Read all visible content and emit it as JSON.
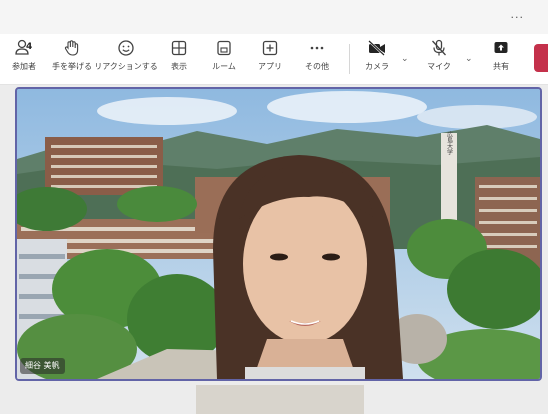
{
  "window": {
    "more_label": "..."
  },
  "toolbar": {
    "participants": {
      "label": "参加者",
      "count": "4",
      "icon": "people-icon"
    },
    "raise_hand": {
      "label": "手を挙げる",
      "icon": "hand-icon"
    },
    "reactions": {
      "label": "リアクションする",
      "icon": "smile-icon"
    },
    "view": {
      "label": "表示",
      "icon": "grid-icon"
    },
    "rooms": {
      "label": "ルーム",
      "icon": "rooms-icon"
    },
    "apps": {
      "label": "アプリ",
      "icon": "plus-square-icon"
    },
    "more": {
      "label": "その他",
      "icon": "ellipsis-icon"
    },
    "camera": {
      "label": "カメラ",
      "state": "off",
      "icon": "camera-off-icon"
    },
    "mic": {
      "label": "マイク",
      "state": "muted",
      "icon": "mic-off-icon"
    },
    "share": {
      "label": "共有",
      "icon": "share-icon"
    },
    "leave_color": "#c4314b"
  },
  "video": {
    "participant_name": "細谷 美帆",
    "tower_text": "広島大学",
    "active_border_color": "#6264a7"
  }
}
